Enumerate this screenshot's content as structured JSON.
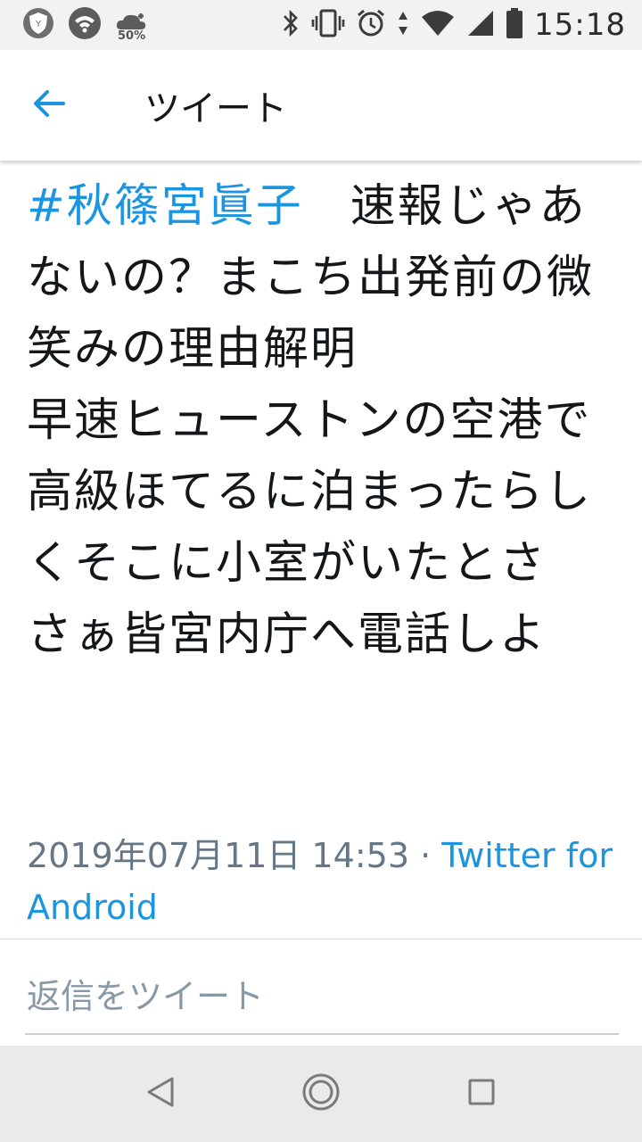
{
  "status_bar": {
    "time": "15:18",
    "battery_saver_percent": "50%",
    "icons": [
      "vpn-shield-icon",
      "wifi-icon",
      "weather-icon",
      "bluetooth-icon",
      "vibrate-icon",
      "alarm-icon",
      "data-arrows-icon",
      "wifi-signal-icon",
      "cell-signal-icon",
      "battery-icon"
    ]
  },
  "app_bar": {
    "title": "ツイート",
    "back_icon": "arrow-left-icon"
  },
  "tweet": {
    "hashtag": "#秋篠宮眞子",
    "text": "　速報じゃあないの？まこち出発前の微笑みの理由解明\n早速ヒューストンの空港で高級ほてるに泊まったらしくそこに小室がいたとさ　さぁ皆宮内庁へ電話しよ",
    "timestamp": "2019年07月11日 14:53",
    "separator": " · ",
    "source": "Twitter for Android"
  },
  "reply": {
    "placeholder": "返信をツイート"
  },
  "colors": {
    "link": "#1b95e0",
    "meta": "#657786",
    "text": "#14171a"
  }
}
